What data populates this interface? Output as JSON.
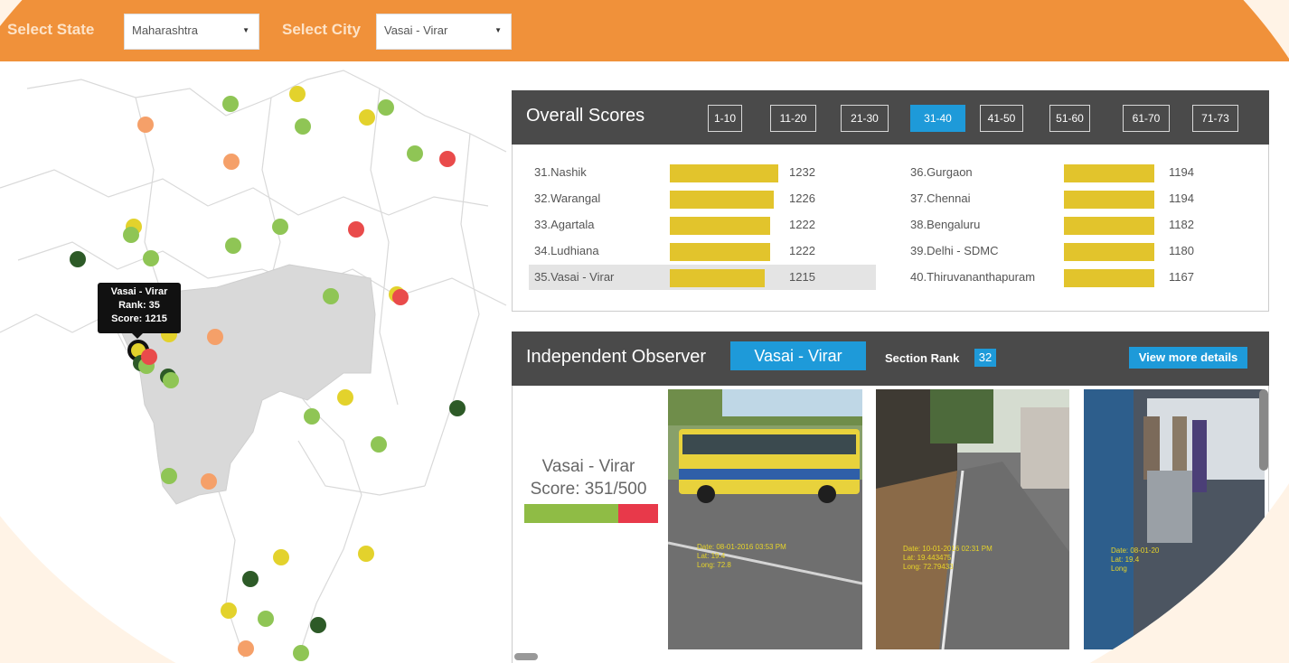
{
  "topbar": {
    "state_label": "Select State",
    "state_value": "Maharashtra",
    "city_label": "Select City",
    "city_value": "Vasai - Virar"
  },
  "tooltip": {
    "city": "Vasai - Virar",
    "rank": "Rank: 35",
    "score": "Score: 1215"
  },
  "overall": {
    "title": "Overall Scores",
    "ranges": [
      "1-10",
      "11-20",
      "21-30",
      "31-40",
      "41-50",
      "51-60",
      "61-70",
      "71-73"
    ],
    "active_range": "31-40",
    "rows": [
      {
        "name": "31.Nashik",
        "score": "1232"
      },
      {
        "name": "32.Warangal",
        "score": "1226"
      },
      {
        "name": "33.Agartala",
        "score": "1222"
      },
      {
        "name": "34.Ludhiana",
        "score": "1222"
      },
      {
        "name": "35.Vasai - Virar",
        "score": "1215"
      },
      {
        "name": "36.Gurgaon",
        "score": "1194"
      },
      {
        "name": "37.Chennai",
        "score": "1194"
      },
      {
        "name": "38.Bengaluru",
        "score": "1182"
      },
      {
        "name": "39.Delhi - SDMC",
        "score": "1180"
      },
      {
        "name": "40.Thiruvananthapuram",
        "score": "1167"
      }
    ]
  },
  "observer": {
    "title": "Independent Observer",
    "city_button": "Vasai - Virar",
    "section_rank_label": "Section Rank",
    "section_rank_value": "32",
    "details_button": "View more details",
    "summary_city": "Vasai - Virar",
    "summary_score": "Score: 351/500",
    "score_fraction": 0.702,
    "photos": [
      {
        "date": "Date: 08-01-2016 03:53 PM",
        "lat": "Lat: 19.4",
        "long": "Long: 72.8"
      },
      {
        "date": "Date: 10-01-2016 02:31 PM",
        "lat": "Lat: 19.443475",
        "long": "Long: 72.79433"
      },
      {
        "date": "Date: 08-01-20",
        "lat": "Lat: 19.4",
        "long": "Long"
      }
    ]
  },
  "colors": {
    "topbar": "#f0913a",
    "header": "#4a4a4a",
    "accent": "#1e9ad9",
    "bar": "#e2c42c",
    "score_good": "#8fbc45",
    "score_bad": "#e8394a",
    "dot_dark": "#2d5a27",
    "dot_green": "#8fc555",
    "dot_yellow": "#e3d22c",
    "dot_orange": "#f5a069",
    "dot_red": "#e94b4b"
  }
}
